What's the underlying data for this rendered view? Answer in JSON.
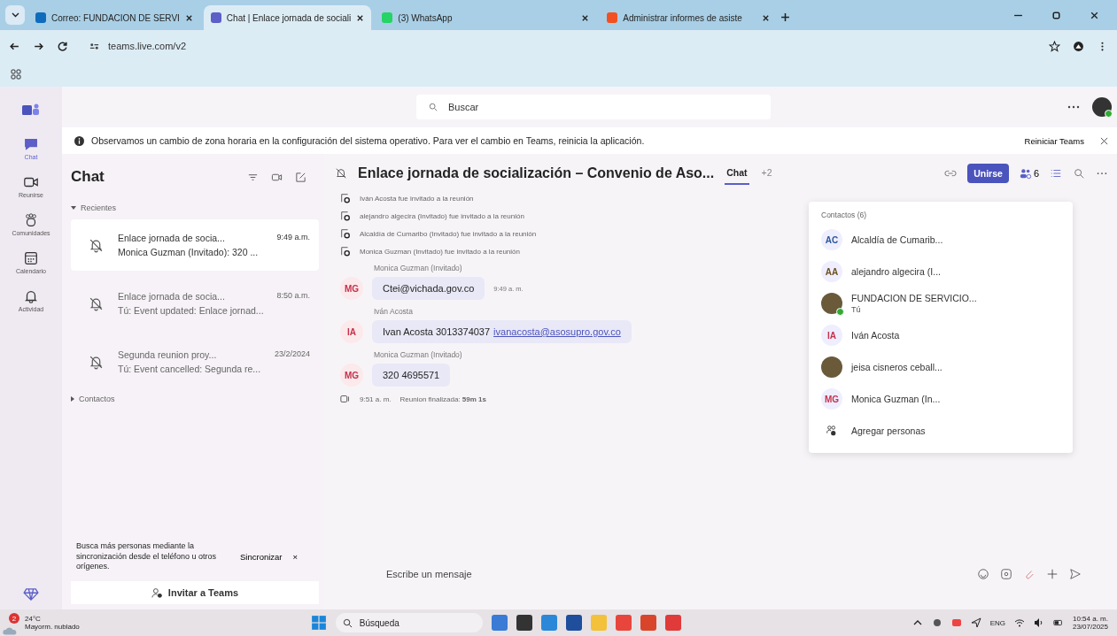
{
  "browser": {
    "tabs": [
      {
        "title": "Correo: FUNDACION DE SERVI",
        "kind": "mail",
        "selected": false
      },
      {
        "title": "Chat | Enlace jornada de sociali",
        "kind": "teams",
        "selected": true
      },
      {
        "title": "(3) WhatsApp",
        "kind": "whatsapp",
        "selected": false
      },
      {
        "title": "Administrar informes de asiste",
        "kind": "ms",
        "selected": false
      }
    ],
    "url": "teams.live.com/v2"
  },
  "teams": {
    "search": {
      "placeholder": "Buscar"
    },
    "rail": [
      {
        "label": "Chat",
        "kind": "chat",
        "selected": true
      },
      {
        "label": "Reunirse",
        "kind": "video",
        "selected": false
      },
      {
        "label": "Comunidades",
        "kind": "people",
        "selected": false
      },
      {
        "label": "Calendario",
        "kind": "calendar",
        "selected": false
      },
      {
        "label": "Actividad",
        "kind": "bell",
        "selected": false
      }
    ],
    "banner": {
      "text": "Observamos un cambio de zona horaria en la configuración del sistema operativo. Para ver el cambio en Teams, reinicia la aplicación.",
      "action": "Reiniciar Teams"
    }
  },
  "chat_list": {
    "title": "Chat",
    "sections": [
      {
        "label": "Recientes",
        "expanded": true,
        "items": [
          {
            "title": "Enlace jornada de socia...",
            "time": "9:49 a.m.",
            "preview": "Monica Guzman (Invitado): 320 ...",
            "selected": true
          },
          {
            "title": "Enlace jornada de socia...",
            "time": "8:50 a.m.",
            "preview": "Tú: Event updated: Enlace jornad...",
            "selected": false
          },
          {
            "title": "Segunda reunion proy...",
            "time": "23/2/2024",
            "preview": "Tú: Event cancelled: Segunda re...",
            "selected": false
          }
        ]
      },
      {
        "label": "Contactos",
        "expanded": false
      }
    ],
    "sync": {
      "text": "Busca más personas mediante la sincronización desde el teléfono u otros orígenes.",
      "action": "Sincronizar",
      "close": "×"
    },
    "invite": "Invitar a Teams"
  },
  "conversation": {
    "title": "Enlace jornada de socialización – Convenio de Aso...",
    "tabs": [
      {
        "label": "Chat",
        "selected": true
      },
      {
        "label": "+2",
        "selected": false
      }
    ],
    "join": "Unirse",
    "participants_count": "6",
    "events": [
      {
        "kind": "system",
        "text": "Iván Acosta fue invitado a la reunión"
      },
      {
        "kind": "system",
        "text": "alejandro algecira (Invitado) fue invitado a la reunión"
      },
      {
        "kind": "system",
        "text": "Alcaldía de Cumaribo (Invitado) fue invitado a la reunión"
      },
      {
        "kind": "system",
        "text": "Monica Guzman (Invitado) fue invitado a la reunión"
      },
      {
        "kind": "message",
        "author": "Monica Guzman (Invitado)",
        "initials": "MG",
        "color": "#c4314b",
        "text": "Ctei@vichada.gov.co",
        "time": "9:49 a. m."
      },
      {
        "kind": "message",
        "author": "Iván Acosta",
        "initials": "IA",
        "color": "#c4314b",
        "text": "Ivan Acosta 3013374037",
        "link": "ivanacosta@asosupro.gov.co"
      },
      {
        "kind": "message",
        "author": "Monica Guzman (Invitado)",
        "initials": "MG",
        "color": "#c4314b",
        "text": "320 4695571"
      },
      {
        "kind": "ended",
        "time": "9:51 a. m.",
        "text": "Reunion finalizada: **59m 1s**"
      }
    ],
    "composer": {
      "placeholder": "Escribe un mensaje"
    }
  },
  "contacts": {
    "heading": "Contactos (6)",
    "items": [
      {
        "kind": "initials",
        "initials": "AC",
        "color": "#2b579a",
        "name": "Alcaldía de Cumarib..."
      },
      {
        "kind": "initials",
        "initials": "AA",
        "color": "#6b4f1d",
        "name": "alejandro algecira (I..."
      },
      {
        "kind": "photo",
        "name": "FUNDACION DE SERVICIO...",
        "subtitle": "Tú",
        "online": true
      },
      {
        "kind": "initials",
        "initials": "IA",
        "color": "#c4314b",
        "name": "Iván Acosta"
      },
      {
        "kind": "photo",
        "name": "jeisa cisneros ceball...",
        "online": false
      },
      {
        "kind": "initials",
        "initials": "MG",
        "color": "#c4314b",
        "name": "Monica Guzman (In..."
      }
    ],
    "add": "Agregar personas"
  },
  "taskbar": {
    "weather": {
      "badge": "2",
      "temp": "24°C",
      "desc": "Mayorm. nublado"
    },
    "search": "Búsqueda",
    "lang": "ENG",
    "time": "10:54 a. m.",
    "date": "23/07/2025"
  }
}
